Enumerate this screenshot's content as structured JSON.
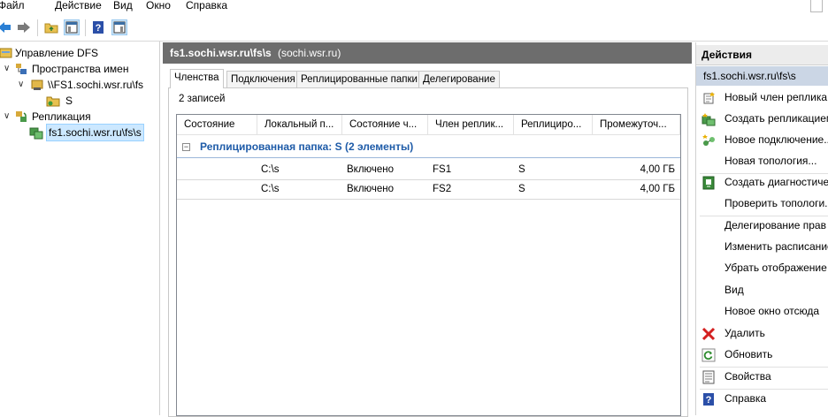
{
  "menu": [
    "Файл",
    "Действие",
    "Вид",
    "Окно",
    "Справка"
  ],
  "tree": {
    "root": "Управление DFS",
    "namespaces": "Пространства имен",
    "namespace_item": "\\\\FS1.sochi.wsr.ru\\fs",
    "folder": "S",
    "replication": "Репликация",
    "replication_group": "fs1.sochi.wsr.ru\\fs\\s"
  },
  "center": {
    "title": "fs1.sochi.wsr.ru\\fs\\s",
    "subtitle": "(sochi.wsr.ru)",
    "tabs": [
      "Членства",
      "Подключения",
      "Реплицированные папки",
      "Делегирование"
    ],
    "record_count": "2 записей",
    "columns": [
      "Состояние",
      "Локальный п...",
      "Состояние ч...",
      "Член реплик...",
      "Реплициро...",
      "Промежуточ..."
    ],
    "group_title": "Реплицированная папка: S (2 элементы)",
    "rows": [
      {
        "state": "",
        "local_path": "C:\\s",
        "member_state": "Включено",
        "member": "FS1",
        "folder": "S",
        "staging": "4,00 ГБ"
      },
      {
        "state": "",
        "local_path": "C:\\s",
        "member_state": "Включено",
        "member": "FS2",
        "folder": "S",
        "staging": "4,00 ГБ"
      }
    ]
  },
  "actions": {
    "header": "Действия",
    "subheader": "fs1.sochi.wsr.ru\\fs\\s",
    "items": [
      {
        "label": "Новый член реплика",
        "icon": "new-member-icon"
      },
      {
        "label": "Создать репликацием",
        "icon": "create-replicated-folder-icon"
      },
      {
        "label": "Новое подключение...",
        "icon": "new-connection-icon"
      },
      {
        "label": "Новая топология...",
        "icon": ""
      },
      {
        "label": "Создать диагностичес",
        "icon": "diagnostic-report-icon"
      },
      {
        "label": "Проверить топологи...",
        "icon": ""
      },
      {
        "label": "Делегирование прав у",
        "icon": ""
      },
      {
        "label": "Изменить расписание",
        "icon": ""
      },
      {
        "label": "Убрать отображение",
        "icon": ""
      },
      {
        "label": "Вид",
        "icon": ""
      },
      {
        "label": "Новое окно отсюда",
        "icon": ""
      },
      {
        "label": "Удалить",
        "icon": "delete-icon"
      },
      {
        "label": "Обновить",
        "icon": "refresh-icon"
      },
      {
        "label": "Свойства",
        "icon": "properties-icon"
      },
      {
        "label": "Справка",
        "icon": "help-icon"
      }
    ]
  }
}
